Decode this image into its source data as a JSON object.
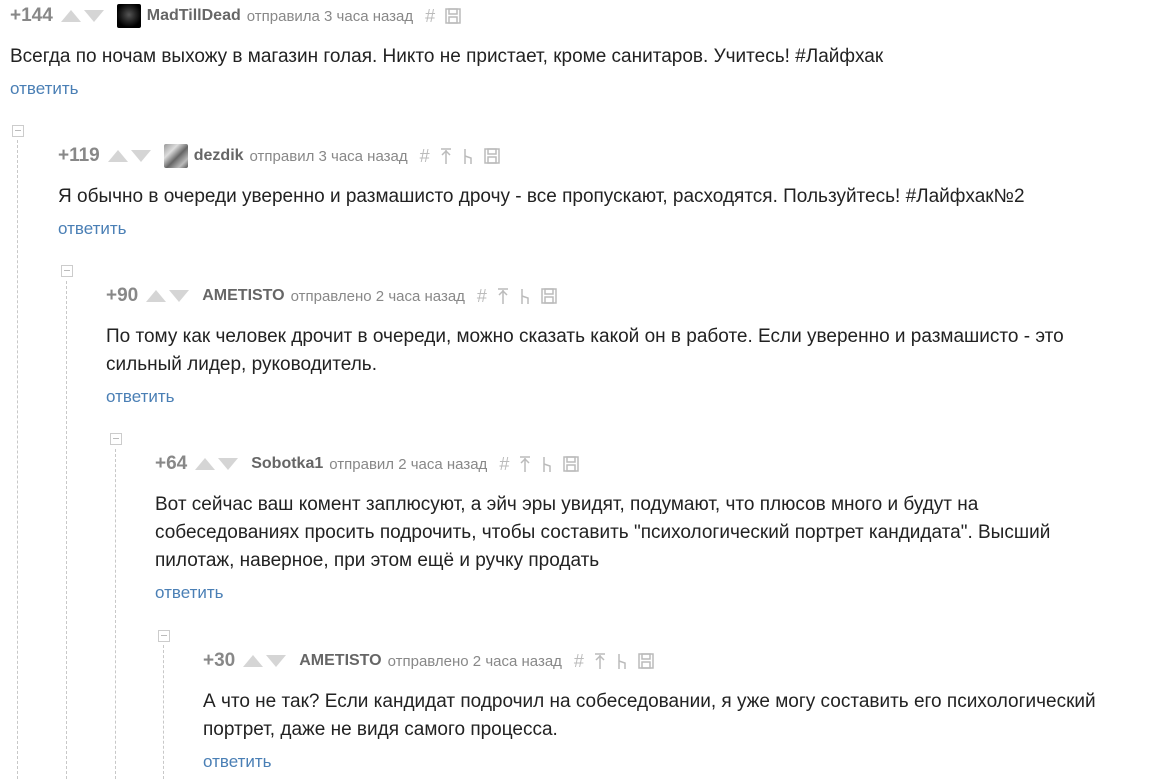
{
  "comments": [
    {
      "rating": "+144",
      "author": "MadTillDead",
      "meta": "отправила 3 часа назад",
      "text": "Всегда по ночам выхожу в магазин голая. Никто не пристает, кроме санитаров. Учитесь! #Лайфхак",
      "reply": "ответить",
      "avatar": "dark-avatar"
    },
    {
      "rating": "+119",
      "author": "dezdik",
      "meta": "отправил 3 часа назад",
      "text": "Я обычно в очереди уверенно и размашисто дрочу - все пропускают, расходятся. Пользуйтесь! #Лайфхак№2",
      "reply": "ответить",
      "avatar": "gray-avatar"
    },
    {
      "rating": "+90",
      "author": "AMETISTO",
      "meta": "отправлено 2 часа назад",
      "text": "По тому как человек дрочит в очереди, можно сказать какой он в работе. Если уверенно и размашисто - это\nсильный лидер, руководитель.",
      "reply": "ответить"
    },
    {
      "rating": "+64",
      "author": "Sobotka1",
      "meta": "отправил 2 часа назад",
      "text": "Вот сейчас ваш комент заплюсуют, а эйч эры увидят, подумают, что плюсов много и будут на\nсобеседованиях просить подрочить, чтобы составить \"психологический портрет кандидата\". Высший\nпилотаж, наверное, при этом ещё и ручку продать",
      "reply": "ответить"
    },
    {
      "rating": "+30",
      "author": "AMETISTO",
      "meta": "отправлено 2 часа назад",
      "text": "А что не так? Если кандидат подрочил на собеседовании, я уже могу составить его психологический\nпортрет, даже не видя самого процесса.",
      "reply": "ответить"
    }
  ],
  "icons": {
    "hash": "#",
    "link_icon": "hash-icon",
    "parent_icon": "arrow-up-icon",
    "branch_icon": "branch-icon",
    "save_icon": "save-icon"
  },
  "colors": {
    "reply_link": "#4a7fb5",
    "rating": "#888888",
    "author": "#666666"
  }
}
